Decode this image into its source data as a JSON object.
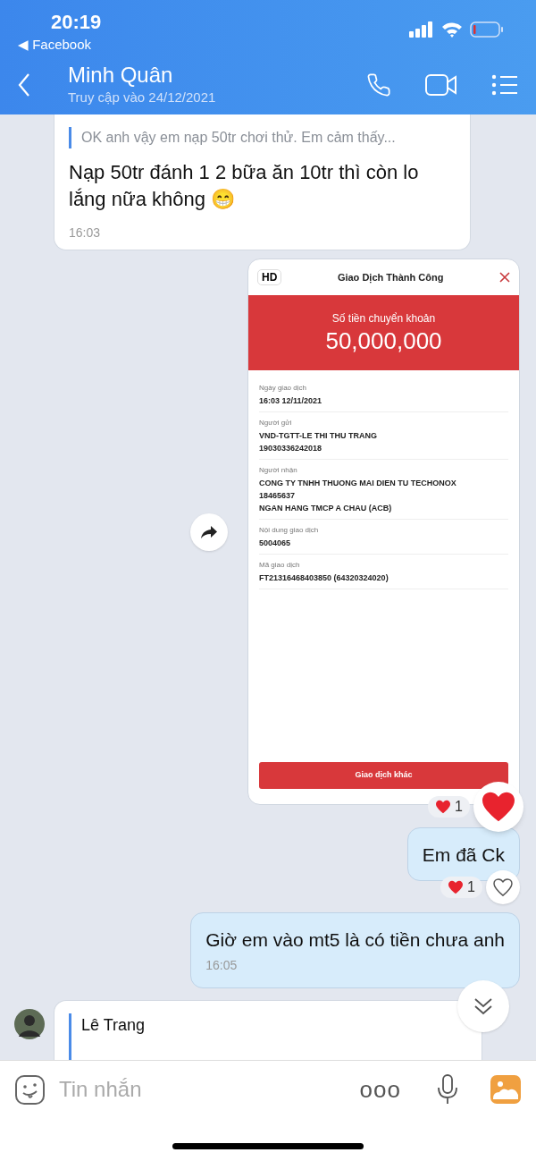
{
  "status_bar": {
    "time": "20:19",
    "back_link": "◀ Facebook"
  },
  "header": {
    "name": "Minh Quân",
    "last_seen": "Truy cập vào 24/12/2021"
  },
  "messages": [
    {
      "kind": "quote_text",
      "outgoing": false,
      "quote": "OK anh vậy em nạp 50tr chơi thử. Em cảm thấy...",
      "text": "Nạp 50tr đánh 1 2 bữa ăn 10tr thì còn lo lắng nữa không 😁",
      "time": "16:03"
    },
    {
      "kind": "receipt",
      "badge": "HD",
      "title": "Giao Dịch Thành Công",
      "amount_label": "Số tiền chuyển khoản",
      "amount": "50,000,000",
      "fields": [
        {
          "label": "Ngày giao dịch",
          "lines": [
            "16:03 12/11/2021"
          ]
        },
        {
          "label": "Người gửi",
          "lines": [
            "VND-TGTT-LE THI THU TRANG",
            "19030336242018"
          ]
        },
        {
          "label": "Người nhận",
          "lines": [
            "CONG TY TNHH THUONG MAI DIEN TU TECHONOX",
            "18465637",
            "NGAN HANG TMCP A CHAU (ACB)"
          ]
        },
        {
          "label": "Nội dung giao dịch",
          "lines": [
            "5004065"
          ]
        },
        {
          "label": "Mã giao dịch",
          "lines": [
            "FT21316468403850 (64320324020)"
          ]
        }
      ],
      "button": "Giao dịch khác",
      "reaction": {
        "count": "1",
        "reacted": true
      }
    },
    {
      "kind": "text",
      "outgoing": true,
      "text": "Em đã Ck",
      "reaction": {
        "count": "1",
        "reacted": false
      }
    },
    {
      "kind": "text",
      "outgoing": true,
      "text": "Giờ em vào mt5 là có tiền chưa anh",
      "time": "16:05"
    },
    {
      "kind": "quote_partial",
      "quote_author": "Lê Trang"
    }
  ],
  "composer": {
    "placeholder": "Tin nhắn",
    "more": "ooo"
  }
}
